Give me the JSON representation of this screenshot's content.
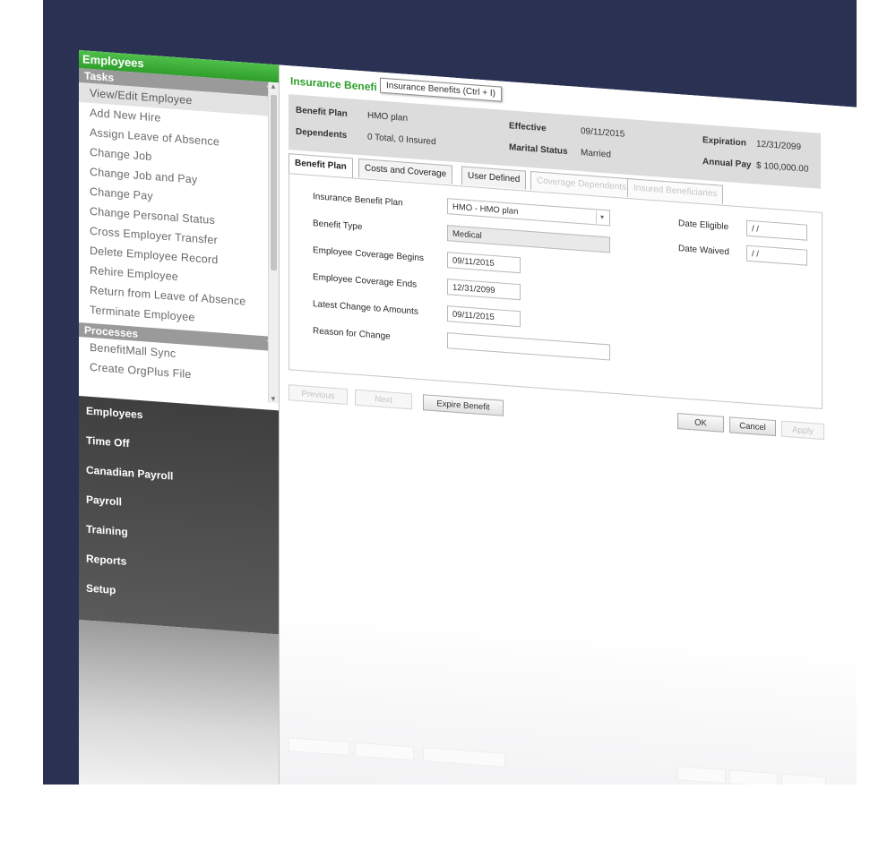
{
  "sidebar": {
    "title": "Employees",
    "tasks_header": "Tasks",
    "tasks": [
      "View/Edit Employee",
      "Add New Hire",
      "Assign Leave of Absence",
      "Change Job",
      "Change Job and Pay",
      "Change Pay",
      "Change Personal Status",
      "Cross Employer Transfer",
      "Delete Employee Record",
      "Rehire Employee",
      "Return from Leave of Absence",
      "Terminate Employee"
    ],
    "processes_header": "Processes",
    "processes": [
      "BenefitMall Sync",
      "Create OrgPlus File"
    ],
    "modules": [
      "Employees",
      "Time Off",
      "Canadian Payroll",
      "Payroll",
      "Training",
      "Reports",
      "Setup"
    ]
  },
  "main": {
    "title": "Insurance Benefi",
    "tooltip": "Insurance Benefits (Ctrl + I)",
    "summary": {
      "benefit_plan_label": "Benefit Plan",
      "benefit_plan_value": "HMO plan",
      "dependents_label": "Dependents",
      "dependents_value": "0 Total, 0 Insured",
      "effective_label": "Effective",
      "effective_value": "09/11/2015",
      "marital_label": "Marital Status",
      "marital_value": "Married",
      "expiration_label": "Expiration",
      "expiration_value": "12/31/2099",
      "annual_pay_label": "Annual Pay",
      "annual_pay_value": "$ 100,000.00"
    },
    "tabs": [
      "Benefit Plan",
      "Costs and Coverage",
      "User Defined",
      "Coverage Dependents",
      "Insured Beneficiaries"
    ],
    "form": {
      "insurance_benefit_plan_label": "Insurance Benefit Plan",
      "insurance_benefit_plan_value": "HMO - HMO plan",
      "benefit_type_label": "Benefit Type",
      "benefit_type_value": "Medical",
      "coverage_begins_label": "Employee Coverage Begins",
      "coverage_begins_value": "09/11/2015",
      "coverage_ends_label": "Employee Coverage Ends",
      "coverage_ends_value": "12/31/2099",
      "latest_change_label": "Latest Change to Amounts",
      "latest_change_value": "09/11/2015",
      "reason_label": "Reason for Change",
      "reason_value": "",
      "date_eligible_label": "Date Eligible",
      "date_eligible_value": "/ /",
      "date_waived_label": "Date Waived",
      "date_waived_value": "/ /"
    },
    "buttons": {
      "previous": "Previous",
      "next": "Next",
      "expire_benefit": "Expire Benefit",
      "ok": "OK",
      "cancel": "Cancel",
      "apply": "Apply"
    }
  },
  "colors": {
    "background": "#2a3152",
    "accent_green": "#2f9e2c",
    "module_panel": "#4a4a4a"
  }
}
